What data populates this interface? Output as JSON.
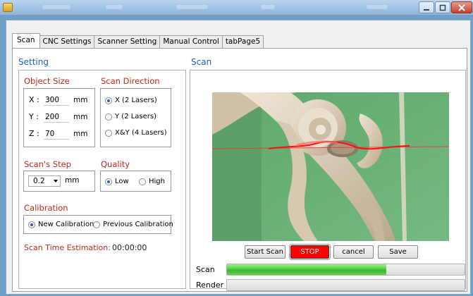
{
  "tabs": [
    "Scan",
    "CNC Settings",
    "Scanner Setting",
    "Manual Control",
    "tabPage5"
  ],
  "setting": {
    "title": "Setting",
    "object_size": {
      "label": "Object Size",
      "fields": [
        {
          "label": "X :",
          "value": "300",
          "unit": "mm"
        },
        {
          "label": "Y :",
          "value": "200",
          "unit": "mm"
        },
        {
          "label": "Z :",
          "value": "70",
          "unit": "mm"
        }
      ]
    },
    "scan_direction": {
      "label": "Scan Direction",
      "options": [
        "X (2 Lasers)",
        "Y (2 Lasers)",
        "X&Y (4 Lasers)"
      ],
      "selected": "X (2 Lasers)"
    },
    "scan_step": {
      "label": "Scan's Step",
      "value": "0.2",
      "unit": "mm"
    },
    "quality": {
      "label": "Quality",
      "options": [
        "Low",
        "High"
      ],
      "selected": "Low"
    },
    "calibration": {
      "label": "Calibration",
      "options": [
        "New Calibration",
        "Previous Calibration"
      ],
      "selected": "New Calibration"
    },
    "time_estimation": {
      "label": "Scan Time Estimation:",
      "value": "00:00:00"
    }
  },
  "scan": {
    "title": "Scan",
    "buttons": {
      "start": "Start Scan",
      "stop": "STOP",
      "cancel": "cancel",
      "save": "Save"
    },
    "progress": [
      {
        "label": "Scan",
        "percent": 67
      },
      {
        "label": "Render",
        "percent": 0
      }
    ]
  },
  "colors": {
    "accent_blue": "#1f5fbf",
    "group_red": "#c0281c",
    "stop_red": "#ff0000",
    "progress_green": "#4bc93a"
  }
}
